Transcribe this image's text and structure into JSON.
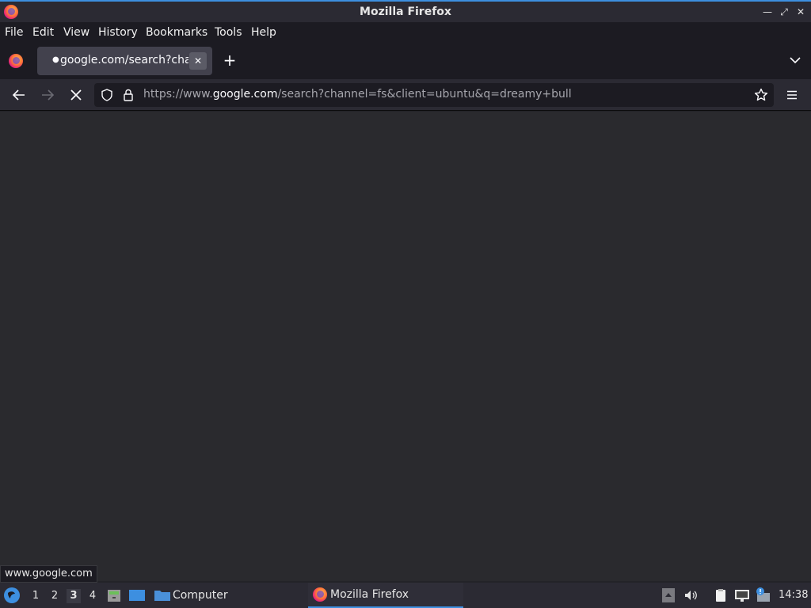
{
  "window": {
    "title": "Mozilla Firefox"
  },
  "menu": {
    "file": "File",
    "edit": "Edit",
    "view": "View",
    "history": "History",
    "bookmarks": "Bookmarks",
    "tools": "Tools",
    "help": "Help"
  },
  "tab": {
    "title": "google.com/search?channel=fs&client=ubuntu&q=dreamy+bull"
  },
  "urlbar": {
    "protocol": "https://www.",
    "host": "google.com",
    "path": "/search?channel=fs&client=ubuntu&q=dreamy+bull"
  },
  "status": {
    "text": "www.google.com"
  },
  "taskbar": {
    "workspaces": [
      "1",
      "2",
      "3",
      "4"
    ],
    "active_workspace": "3",
    "computer_label": "Computer",
    "firefox_label": "Mozilla Firefox",
    "clock": "14:38"
  },
  "colors": {
    "accent": "#3d8fe0",
    "background": "#2a2a2e",
    "tab": "#42414d"
  }
}
